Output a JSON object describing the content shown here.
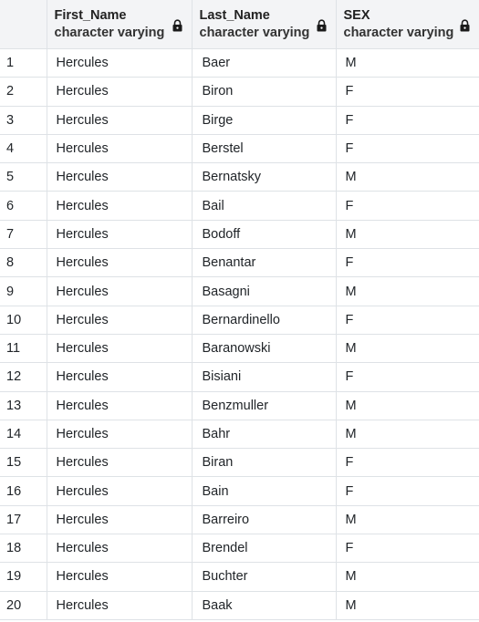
{
  "columns": [
    {
      "name": "First_Name",
      "type": "character varying",
      "locked": true
    },
    {
      "name": "Last_Name",
      "type": "character varying",
      "locked": true
    },
    {
      "name": "SEX",
      "type": "character varying",
      "locked": true
    }
  ],
  "rows": [
    {
      "num": "1",
      "first": "Hercules",
      "last": "Baer",
      "sex": "M"
    },
    {
      "num": "2",
      "first": "Hercules",
      "last": "Biron",
      "sex": "F"
    },
    {
      "num": "3",
      "first": "Hercules",
      "last": "Birge",
      "sex": "F"
    },
    {
      "num": "4",
      "first": "Hercules",
      "last": "Berstel",
      "sex": "F"
    },
    {
      "num": "5",
      "first": "Hercules",
      "last": "Bernatsky",
      "sex": "M"
    },
    {
      "num": "6",
      "first": "Hercules",
      "last": "Bail",
      "sex": "F"
    },
    {
      "num": "7",
      "first": "Hercules",
      "last": "Bodoff",
      "sex": "M"
    },
    {
      "num": "8",
      "first": "Hercules",
      "last": "Benantar",
      "sex": "F"
    },
    {
      "num": "9",
      "first": "Hercules",
      "last": "Basagni",
      "sex": "M"
    },
    {
      "num": "10",
      "first": "Hercules",
      "last": "Bernardinello",
      "sex": "F"
    },
    {
      "num": "11",
      "first": "Hercules",
      "last": "Baranowski",
      "sex": "M"
    },
    {
      "num": "12",
      "first": "Hercules",
      "last": "Bisiani",
      "sex": "F"
    },
    {
      "num": "13",
      "first": "Hercules",
      "last": "Benzmuller",
      "sex": "M"
    },
    {
      "num": "14",
      "first": "Hercules",
      "last": "Bahr",
      "sex": "M"
    },
    {
      "num": "15",
      "first": "Hercules",
      "last": "Biran",
      "sex": "F"
    },
    {
      "num": "16",
      "first": "Hercules",
      "last": "Bain",
      "sex": "F"
    },
    {
      "num": "17",
      "first": "Hercules",
      "last": "Barreiro",
      "sex": "M"
    },
    {
      "num": "18",
      "first": "Hercules",
      "last": "Brendel",
      "sex": "F"
    },
    {
      "num": "19",
      "first": "Hercules",
      "last": "Buchter",
      "sex": "M"
    },
    {
      "num": "20",
      "first": "Hercules",
      "last": "Baak",
      "sex": "M"
    }
  ],
  "icons": {
    "lock": "lock-icon"
  },
  "colors": {
    "header_bg": "#f3f4f6",
    "grid_line": "#dee2e6",
    "text": "#212529"
  }
}
